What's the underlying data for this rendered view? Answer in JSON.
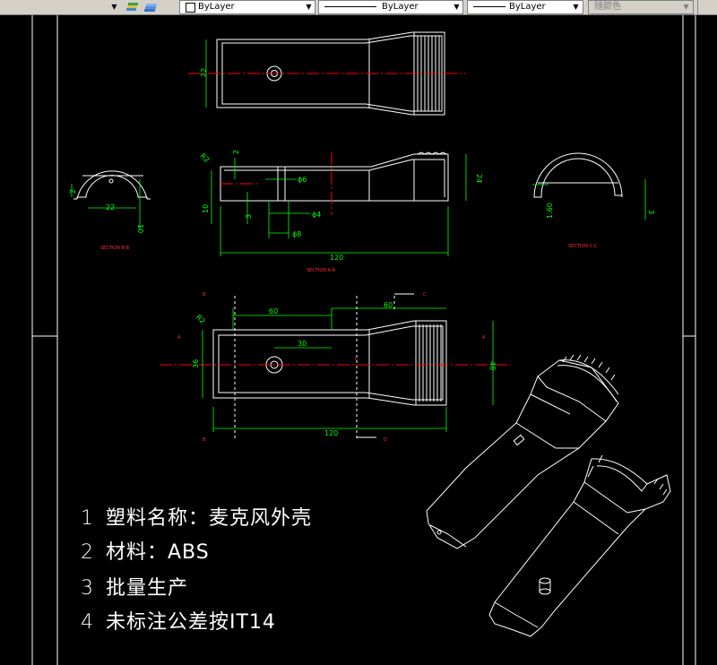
{
  "toolbar": {
    "layer_state": "",
    "color_label": "ByLayer",
    "linetype_label": "ByLayer",
    "lineweight_label": "ByLayer",
    "plotstyle_label": "随颜色"
  },
  "drawing": {
    "section_bb": "SECTION B-B",
    "section_aa": "SECTION A-A",
    "section_cc": "SECTION C-C",
    "dims": {
      "d22_top": "22",
      "r2_top": "R2",
      "d2": "2",
      "d6": "ϕ6",
      "d4": "ϕ4",
      "d8": "ϕ8",
      "d24": "24",
      "d10": "10",
      "d3": "3",
      "d120_mid": "120",
      "d2_bb": "2",
      "d22_bb": "22",
      "d10_bb": "10",
      "d160_cc": "1.60",
      "d3_cc": "3",
      "d60_left": "60",
      "d60_right": "60",
      "d30": "30",
      "r2_bot": "R2",
      "d36": "36",
      "d48": "48",
      "d120_bot": "120",
      "lbl_b1": "B",
      "lbl_b2": "B",
      "lbl_c1": "C",
      "lbl_c2": "C",
      "lbl_d": "D",
      "lbl_a1": "A",
      "lbl_a2": "A",
      "lbl_c_center": "C"
    }
  },
  "notes": [
    {
      "num": "1",
      "text": "塑料名称：麦克风外壳"
    },
    {
      "num": "2",
      "text": "材料：ABS"
    },
    {
      "num": "3",
      "text": "批量生产"
    },
    {
      "num": "4",
      "text": "未标注公差按IT14"
    }
  ]
}
